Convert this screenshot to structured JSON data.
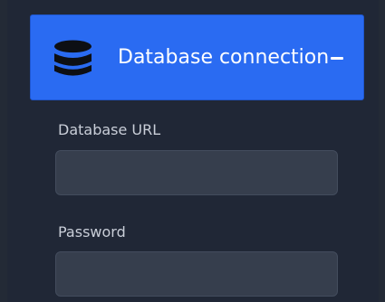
{
  "header": {
    "title": "Database connection",
    "icon": "database-icon",
    "toggle_icon": "collapse-minus-icon"
  },
  "form": {
    "url_label": "Database URL",
    "url_value": "",
    "password_label": "Password",
    "password_value": ""
  },
  "colors": {
    "accent": "#2a6bf2",
    "background": "#202736",
    "field_bg": "#363e4d",
    "label_text": "#c9ced8"
  }
}
